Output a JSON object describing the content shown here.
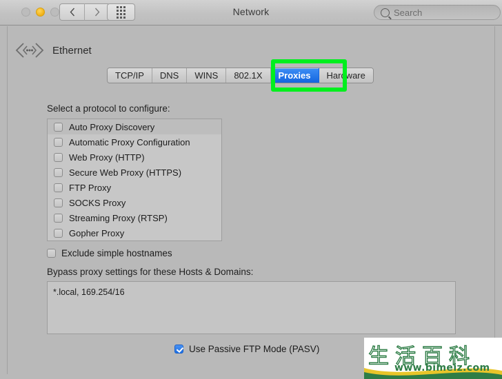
{
  "window": {
    "title": "Network",
    "traffic_lights": [
      {
        "name": "close",
        "color": "#bcbcbc",
        "state": "disabled"
      },
      {
        "name": "minimize",
        "color": "#f0b016",
        "state": "enabled"
      },
      {
        "name": "zoom",
        "color": "#bcbcbc",
        "state": "disabled"
      }
    ],
    "nav_back_icon": "chevron-left-icon",
    "nav_forward_icon": "chevron-right-icon",
    "show_all_icon": "grid-dots-icon"
  },
  "search": {
    "placeholder": "Search",
    "value": "",
    "icon": "search-icon"
  },
  "interface": {
    "name": "Ethernet",
    "icon": "ethernet-icon"
  },
  "tabs": {
    "items": [
      {
        "label": "TCP/IP",
        "selected": false
      },
      {
        "label": "DNS",
        "selected": false
      },
      {
        "label": "WINS",
        "selected": false
      },
      {
        "label": "802.1X",
        "selected": false
      },
      {
        "label": "Proxies",
        "selected": true
      },
      {
        "label": "Hardware",
        "selected": false
      }
    ],
    "selected": "Proxies",
    "highlight_color": "#00ef1e",
    "selected_color": "#1365e0"
  },
  "proxies": {
    "protocol_label": "Select a protocol to configure:",
    "protocols": [
      {
        "label": "Auto Proxy Discovery",
        "checked": false
      },
      {
        "label": "Automatic Proxy Configuration",
        "checked": false
      },
      {
        "label": "Web Proxy (HTTP)",
        "checked": false
      },
      {
        "label": "Secure Web Proxy (HTTPS)",
        "checked": false
      },
      {
        "label": "FTP Proxy",
        "checked": false
      },
      {
        "label": "SOCKS Proxy",
        "checked": false
      },
      {
        "label": "Streaming Proxy (RTSP)",
        "checked": false
      },
      {
        "label": "Gopher Proxy",
        "checked": false
      }
    ],
    "exclude_simple_hostnames": {
      "label": "Exclude simple hostnames",
      "checked": false
    },
    "bypass_label": "Bypass proxy settings for these Hosts & Domains:",
    "bypass_value": "*.local, 169.254/16",
    "passive_ftp": {
      "label": "Use Passive FTP Mode (PASV)",
      "checked": true
    }
  },
  "watermark": {
    "title": "生活百科",
    "url": "www.bimeiz.com",
    "color": "#2e7d46"
  }
}
